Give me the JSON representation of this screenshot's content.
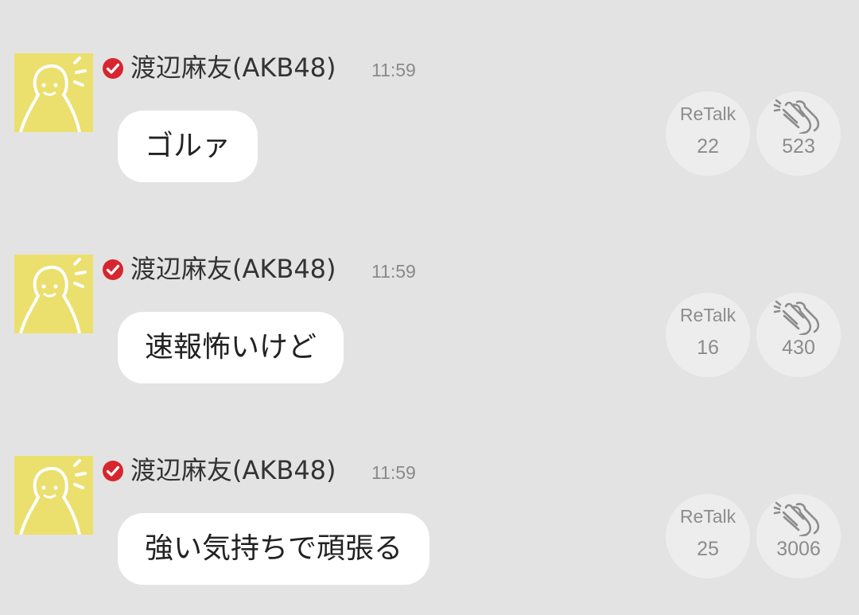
{
  "messages": [
    {
      "author": "渡辺麻友(AKB48)",
      "time": "11:59",
      "text": "ゴルァ",
      "retalk_label": "ReTalk",
      "retalk_count": "22",
      "clap_count": "523"
    },
    {
      "author": "渡辺麻友(AKB48)",
      "time": "11:59",
      "text": "速報怖いけど",
      "retalk_label": "ReTalk",
      "retalk_count": "16",
      "clap_count": "430"
    },
    {
      "author": "渡辺麻友(AKB48)",
      "time": "11:59",
      "text": "強い気持ちで頑張る",
      "retalk_label": "ReTalk",
      "retalk_count": "25",
      "clap_count": "3006"
    }
  ],
  "colors": {
    "background": "#e3e3e3",
    "avatar": "#ebdf6d",
    "verified": "#d7262f",
    "bubble": "#ffffff"
  },
  "icons": {
    "avatar": "avatar-figure-icon",
    "verified": "verified-check-icon",
    "clap": "clap-icon"
  }
}
